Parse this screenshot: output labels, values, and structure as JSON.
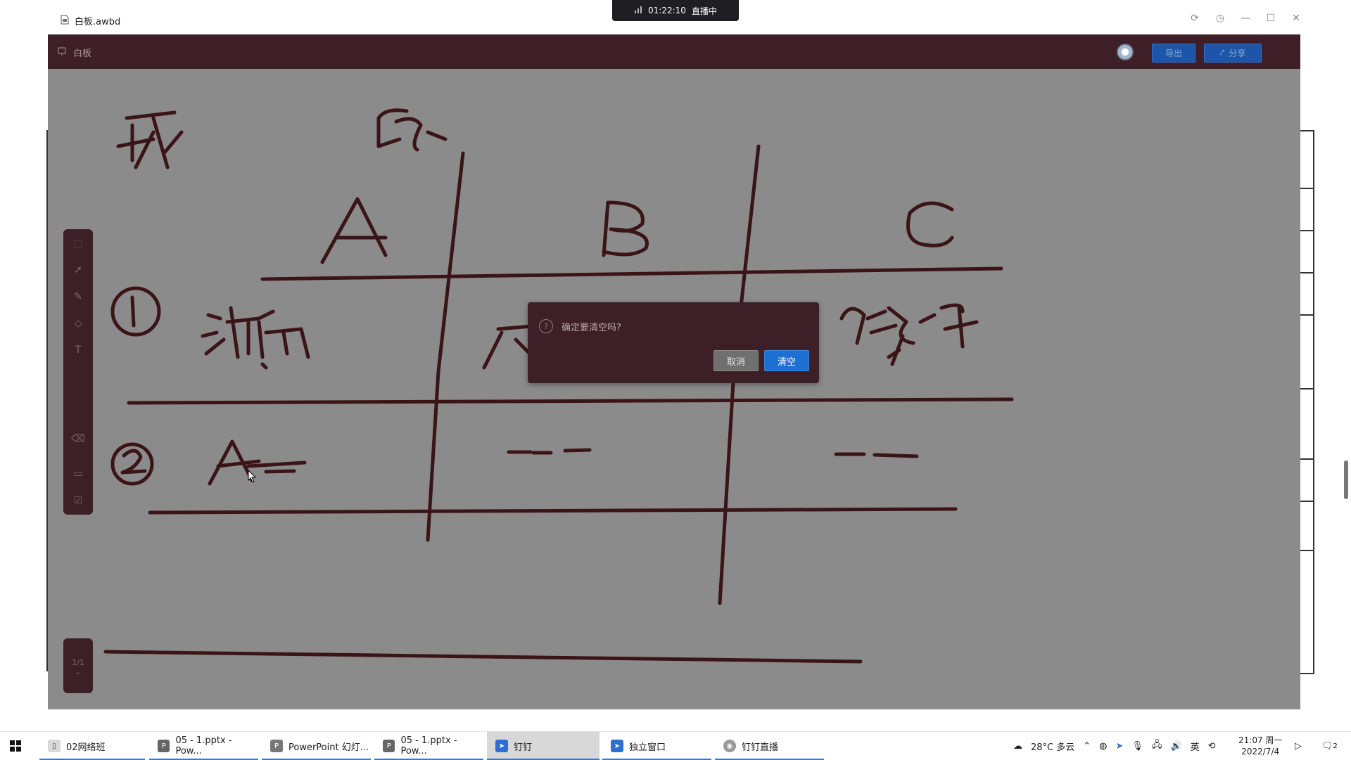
{
  "window": {
    "file_title": "白板.awbd",
    "live_timer": "01:22:10",
    "live_status": "直播中"
  },
  "app": {
    "title": "白板",
    "export_label": "导出",
    "share_label": "分享",
    "page_indicator": "1/1"
  },
  "dialog": {
    "message": "确定要清空吗?",
    "cancel_label": "取消",
    "confirm_label": "清空"
  },
  "taskbar": {
    "items": [
      {
        "label": "02网络班",
        "icon": "folder-icon"
      },
      {
        "label": "05 - 1.pptx - Pow...",
        "icon": "powerpoint-icon"
      },
      {
        "label": "PowerPoint 幻灯...",
        "icon": "powerpoint-slideshow-icon"
      },
      {
        "label": "05 - 1.pptx - Pow...",
        "icon": "powerpoint-icon"
      },
      {
        "label": "钉钉",
        "icon": "dingtalk-icon"
      },
      {
        "label": "独立窗口",
        "icon": "dingtalk-icon"
      },
      {
        "label": "钉钉直播",
        "icon": "live-icon"
      }
    ],
    "weather": "28°C 多云",
    "time": "21:07 周一",
    "date": "2022/7/4",
    "notification_count": "2"
  }
}
